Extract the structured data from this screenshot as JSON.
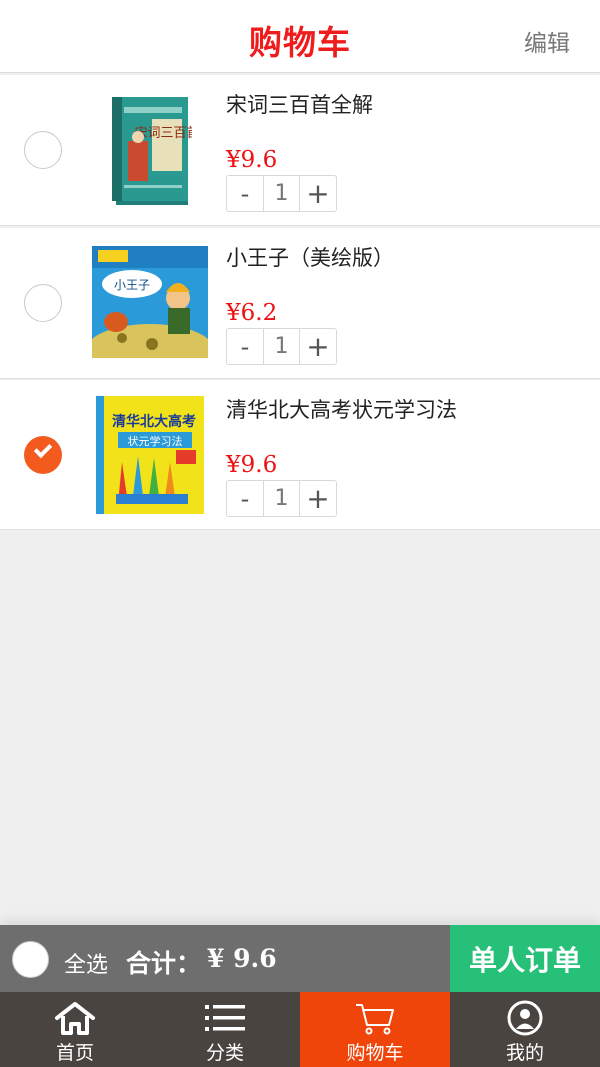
{
  "header": {
    "title": "购物车",
    "edit_label": "编辑"
  },
  "cart": {
    "items": [
      {
        "name": "宋词三百首全解",
        "price": "¥9.6",
        "quantity": "1",
        "checked": false,
        "cover_title": "宋词三百首"
      },
      {
        "name": "小王子（美绘版）",
        "price": "¥6.2",
        "quantity": "1",
        "checked": false,
        "cover_title": "小王子"
      },
      {
        "name": "清华北大高考状元学习法",
        "price": "¥9.6",
        "quantity": "1",
        "checked": true,
        "cover_title": "清华北大高考",
        "cover_subtitle": "状元学习法"
      }
    ],
    "minus_symbol": "-",
    "plus_symbol": "+"
  },
  "footer": {
    "select_all_label": "全选",
    "total_label": "合计：",
    "total_value": "¥ 9.6",
    "order_button_label": "单人订单"
  },
  "tabbar": {
    "tabs": [
      {
        "label": "首页",
        "icon": "home-icon",
        "active": false
      },
      {
        "label": "分类",
        "icon": "list-icon",
        "active": false
      },
      {
        "label": "购物车",
        "icon": "cart-icon",
        "active": true
      },
      {
        "label": "我的",
        "icon": "user-icon",
        "active": false
      }
    ]
  },
  "colors": {
    "title_red": "#ee1c1c",
    "price_red": "#ee1111",
    "checked_orange": "#f25a1e",
    "order_green": "#27c078",
    "active_tab": "#f0450a",
    "tabbar_bg": "#4a4440"
  }
}
